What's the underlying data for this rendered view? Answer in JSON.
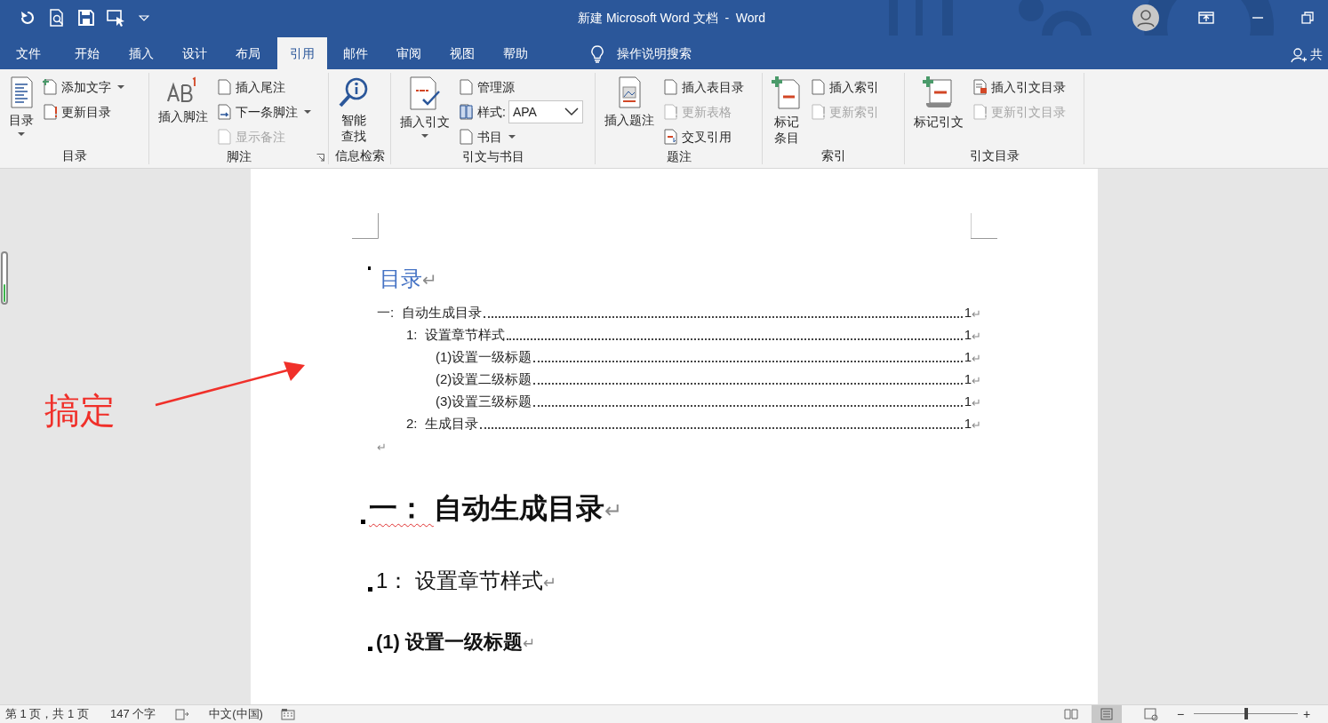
{
  "window": {
    "title": "新建 Microsoft Word 文档  -  Word"
  },
  "tabs": [
    {
      "label": "文件",
      "selected": false
    },
    {
      "label": "开始",
      "selected": false
    },
    {
      "label": "插入",
      "selected": false
    },
    {
      "label": "设计",
      "selected": false
    },
    {
      "label": "布局",
      "selected": false
    },
    {
      "label": "引用",
      "selected": true
    },
    {
      "label": "邮件",
      "selected": false
    },
    {
      "label": "审阅",
      "selected": false
    },
    {
      "label": "视图",
      "selected": false
    },
    {
      "label": "帮助",
      "selected": false
    }
  ],
  "tell_me": "操作说明搜索",
  "share": "共",
  "ribbon": [
    {
      "label": "目录",
      "launcher": false,
      "items": [
        {
          "kind": "large",
          "lines": [
            "目录"
          ],
          "dropdown": true,
          "disabled": false
        },
        {
          "kind": "small",
          "label": "添加文字",
          "dropdown": true,
          "disabled": false
        },
        {
          "kind": "small",
          "label": "更新目录",
          "dropdown": false,
          "disabled": false
        }
      ]
    },
    {
      "label": "脚注",
      "launcher": true,
      "items": [
        {
          "kind": "large",
          "lines": [
            "插入脚注"
          ],
          "dropdown": false,
          "disabled": false
        },
        {
          "kind": "small",
          "label": "插入尾注",
          "dropdown": false,
          "disabled": false
        },
        {
          "kind": "small",
          "label": "下一条脚注",
          "dropdown": true,
          "disabled": false
        },
        {
          "kind": "small",
          "label": "显示备注",
          "dropdown": false,
          "disabled": true
        }
      ]
    },
    {
      "label": "信息检索",
      "launcher": false,
      "items": [
        {
          "kind": "large",
          "lines": [
            "智能",
            "查找"
          ],
          "dropdown": false,
          "disabled": false
        }
      ]
    },
    {
      "label": "引文与书目",
      "launcher": false,
      "items": [
        {
          "kind": "large",
          "lines": [
            "插入引文"
          ],
          "dropdown": true,
          "disabled": false
        },
        {
          "kind": "small",
          "label": "管理源",
          "dropdown": false,
          "disabled": false
        },
        {
          "kind": "combo",
          "label": "样式:",
          "value": "APA",
          "dropdown": true,
          "disabled": false
        },
        {
          "kind": "small",
          "label": "书目",
          "dropdown": true,
          "disabled": false
        }
      ]
    },
    {
      "label": "题注",
      "launcher": false,
      "items": [
        {
          "kind": "large",
          "lines": [
            "插入题注"
          ],
          "dropdown": false,
          "disabled": false
        },
        {
          "kind": "small",
          "label": "插入表目录",
          "dropdown": false,
          "disabled": false
        },
        {
          "kind": "small",
          "label": "更新表格",
          "dropdown": false,
          "disabled": true
        },
        {
          "kind": "small",
          "label": "交叉引用",
          "dropdown": false,
          "disabled": false
        }
      ]
    },
    {
      "label": "索引",
      "launcher": false,
      "items": [
        {
          "kind": "large",
          "lines": [
            "标记",
            "条目"
          ],
          "dropdown": false,
          "disabled": false
        },
        {
          "kind": "small",
          "label": "插入索引",
          "dropdown": false,
          "disabled": false
        },
        {
          "kind": "small",
          "label": "更新索引",
          "dropdown": false,
          "disabled": true
        }
      ]
    },
    {
      "label": "引文目录",
      "launcher": false,
      "items": [
        {
          "kind": "large",
          "lines": [
            "标记引文"
          ],
          "dropdown": false,
          "disabled": false
        },
        {
          "kind": "small",
          "label": "插入引文目录",
          "dropdown": false,
          "disabled": false
        },
        {
          "kind": "small",
          "label": "更新引文目录",
          "dropdown": false,
          "disabled": true
        }
      ]
    }
  ],
  "annotation": {
    "text": "搞定"
  },
  "document": {
    "toc_title": "目录",
    "end_mark": "↵",
    "toc": [
      {
        "number": "一:",
        "text": "自动生成目录",
        "page": "1",
        "children": [
          {
            "number": "1:",
            "text": "设置章节样式",
            "page": "1",
            "children": [
              {
                "number": "(1)",
                "text": "设置一级标题",
                "page": "1"
              },
              {
                "number": "(2)",
                "text": "设置二级标题",
                "page": "1"
              },
              {
                "number": "(3)",
                "text": "设置三级标题",
                "page": "1"
              }
            ]
          },
          {
            "number": "2:",
            "text": "生成目录",
            "page": "1"
          }
        ]
      }
    ],
    "headings": [
      {
        "kind": "h1",
        "number": "一：",
        "text": "自动生成目录",
        "flagged": true
      },
      {
        "kind": "h2",
        "number": "1：",
        "text": "设置章节样式",
        "flagged": false
      },
      {
        "kind": "h3",
        "number": "(1)",
        "text": "设置一级标题",
        "flagged": false
      }
    ]
  },
  "status_bar": {
    "page": "第 1 页，共 1 页",
    "words": "147 个字",
    "language": "中文(中国)",
    "views": [
      {
        "selected": false
      },
      {
        "selected": true
      },
      {
        "selected": false
      }
    ],
    "zoom_out": "−",
    "zoom_in": "+",
    "zoom": {
      "level": 0.5
    }
  }
}
